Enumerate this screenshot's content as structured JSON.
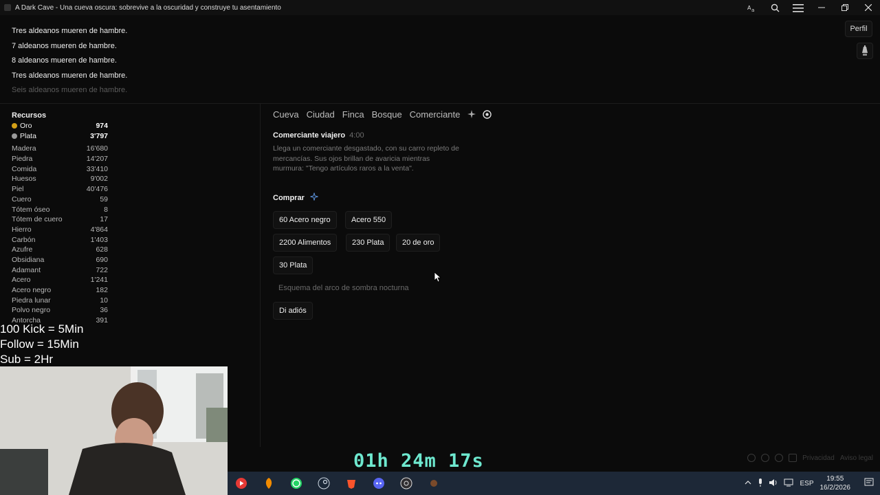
{
  "window": {
    "title": "A Dark Cave - Una cueva oscura: sobrevive a la oscuridad y construye tu asentamiento"
  },
  "log": [
    {
      "text": "Tres aldeanos mueren de hambre.",
      "faded": false
    },
    {
      "text": "7 aldeanos mueren de hambre.",
      "faded": false
    },
    {
      "text": "8 aldeanos mueren de hambre.",
      "faded": false
    },
    {
      "text": "Tres aldeanos mueren de hambre.",
      "faded": false
    },
    {
      "text": "Seis aldeanos mueren de hambre.",
      "faded": true
    }
  ],
  "header": {
    "profile_label": "Perfil",
    "light_icon": "lamp-icon"
  },
  "resources": {
    "title": "Recursos",
    "money": [
      {
        "name": "Oro",
        "value": "974",
        "color": "#d4a017"
      },
      {
        "name": "Plata",
        "value": "3'797",
        "color": "#9a9a9a"
      }
    ],
    "items": [
      {
        "name": "Madera",
        "value": "16'680"
      },
      {
        "name": "Piedra",
        "value": "14'207"
      },
      {
        "name": "Comida",
        "value": "33'410"
      },
      {
        "name": "Huesos",
        "value": "9'002"
      },
      {
        "name": "Piel",
        "value": "40'476"
      },
      {
        "name": "Cuero",
        "value": "59"
      },
      {
        "name": "Tótem óseo",
        "value": "8"
      },
      {
        "name": "Tótem de cuero",
        "value": "17"
      },
      {
        "name": "Hierro",
        "value": "4'864"
      },
      {
        "name": "Carbón",
        "value": "1'403"
      },
      {
        "name": "Azufre",
        "value": "628"
      },
      {
        "name": "Obsidiana",
        "value": "690"
      },
      {
        "name": "Adamant",
        "value": "722"
      },
      {
        "name": "Acero",
        "value": "1'241"
      },
      {
        "name": "Acero negro",
        "value": "182"
      },
      {
        "name": "Piedra lunar",
        "value": "10"
      },
      {
        "name": "Polvo negro",
        "value": "36"
      },
      {
        "name": "Antorcha",
        "value": "391"
      }
    ]
  },
  "tabs": [
    "Cueva",
    "Ciudad",
    "Finca",
    "Bosque",
    "Comerciante"
  ],
  "merchant": {
    "title": "Comerciante viajero",
    "timer": "4:00",
    "description": "Llega un comerciante desgastado, con su carro repleto de mercancías. Sus ojos brillan de avaricia mientras murmura: \"Tengo artículos raros a la venta\".",
    "buy_label": "Comprar",
    "offers": [
      "60 Acero negro",
      "Acero 550",
      "2200 Alimentos",
      "230 Plata",
      "20 de oro",
      "30 Plata"
    ],
    "disabled_offer": "Esquema del arco de sombra nocturna",
    "goodbye_label": "Di adiós"
  },
  "footer": {
    "privacy": "Privacidad",
    "legal": "Aviso legal"
  },
  "stream": {
    "lines": [
      "100 Kick = 5Min",
      "Follow = 15Min",
      "Sub = 2Hr"
    ],
    "timer": "01h 24m 17s"
  },
  "taskbar": {
    "language": "ESP",
    "time": "19:55",
    "date": "16/2/2026"
  }
}
